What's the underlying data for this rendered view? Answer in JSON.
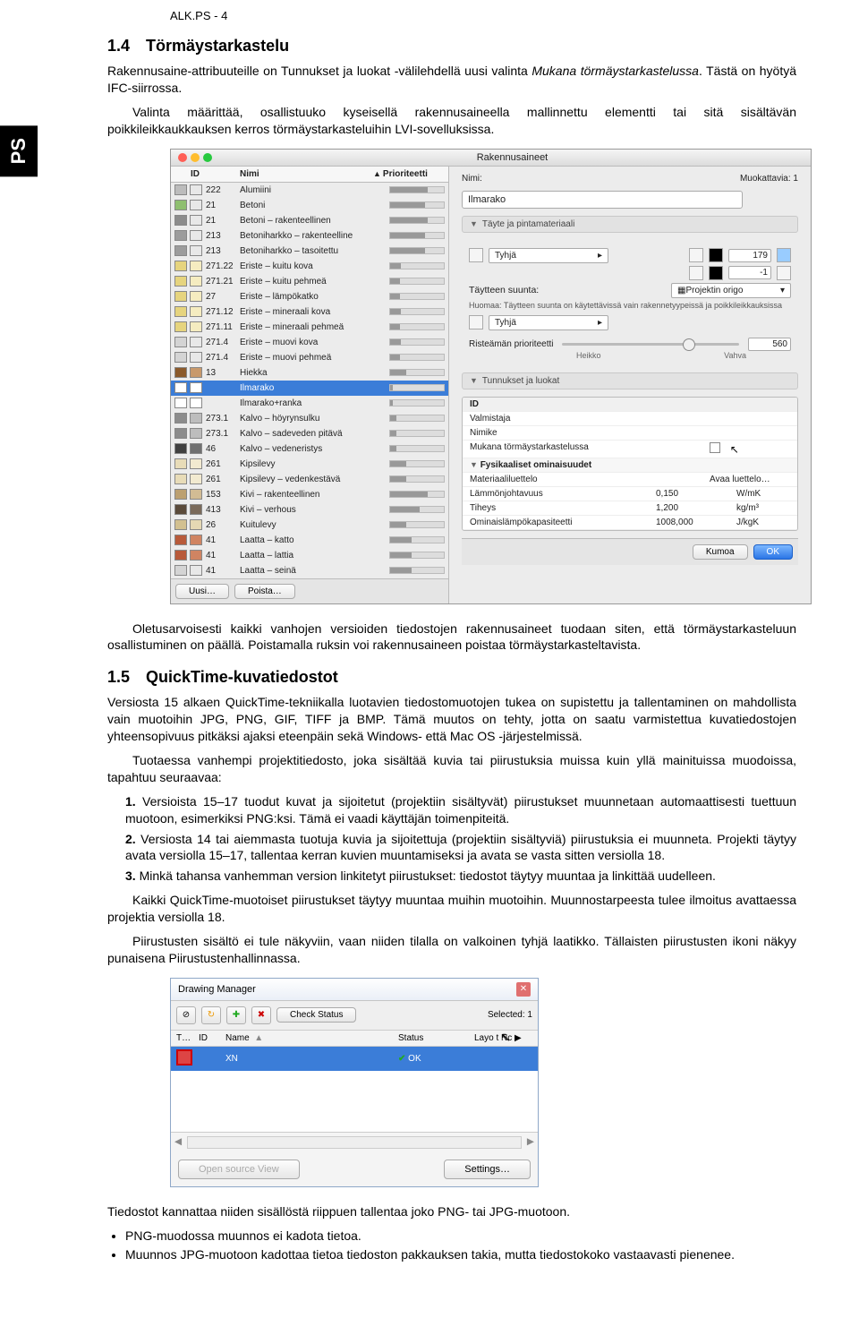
{
  "header": {
    "code": "ALK.PS - 4"
  },
  "ps_tab": "PS",
  "section14": {
    "title": "1.4 Törmäystarkastelu",
    "para1_a": "Rakennusaine-attribuuteille on Tunnukset ja luokat -välilehdellä uusi valinta ",
    "para1_em": "Mukana törmäystarkastelussa",
    "para1_b": ". Tästä on hyötyä IFC-siirrossa.",
    "para2": "Valinta määrittää, osallistuuko kyseisellä rakennusaineella mallinnettu elementti tai sitä sisältävän poikkileikkaukkauksen kerros törmäystarkasteluihin LVI-sovelluksissa."
  },
  "dialog1": {
    "title": "Rakennusaineet",
    "columns": {
      "id": "ID",
      "name": "Nimi",
      "prio": "Prioriteetti"
    },
    "materials": [
      {
        "sw": "#bcbcbc",
        "sw2": "#e8e8e8",
        "id": "222",
        "name": "Alumiini",
        "p": 70
      },
      {
        "sw": "#8fbf70",
        "sw2": "#e8e8e8",
        "id": "21",
        "name": "Betoni",
        "p": 65
      },
      {
        "sw": "#8c8c8c",
        "sw2": "#e8e8e8",
        "id": "21",
        "name": "Betoni – rakenteellinen",
        "p": 70
      },
      {
        "sw": "#9c9c9c",
        "sw2": "#e8e8e8",
        "id": "213",
        "name": "Betoniharkko – rakenteelline",
        "p": 65
      },
      {
        "sw": "#9c9c9c",
        "sw2": "#e8e8e8",
        "id": "213",
        "name": "Betoniharkko – tasoitettu",
        "p": 65
      },
      {
        "sw": "#e6d47e",
        "sw2": "#f5ecc0",
        "id": "271.22",
        "name": "Eriste – kuitu kova",
        "p": 20
      },
      {
        "sw": "#e6d47e",
        "sw2": "#f5ecc0",
        "id": "271.21",
        "name": "Eriste – kuitu pehmeä",
        "p": 18
      },
      {
        "sw": "#e6d47e",
        "sw2": "#f5ecc0",
        "id": "27",
        "name": "Eriste – lämpökatko",
        "p": 18
      },
      {
        "sw": "#e6d47e",
        "sw2": "#f5ecc0",
        "id": "271.12",
        "name": "Eriste – mineraali kova",
        "p": 20
      },
      {
        "sw": "#e6d47e",
        "sw2": "#f5ecc0",
        "id": "271.11",
        "name": "Eriste – mineraali pehmeä",
        "p": 18
      },
      {
        "sw": "#d4d4d4",
        "sw2": "#e8e8e8",
        "id": "271.4",
        "name": "Eriste – muovi kova",
        "p": 20
      },
      {
        "sw": "#d4d4d4",
        "sw2": "#e8e8e8",
        "id": "271.4",
        "name": "Eriste – muovi pehmeä",
        "p": 18
      },
      {
        "sw": "#8b5a2b",
        "sw2": "#c8996b",
        "id": "13",
        "name": "Hiekka",
        "p": 30
      },
      {
        "sw": "#ffffff",
        "sw2": "#ffffff",
        "id": "",
        "name": "Ilmarako",
        "p": 5,
        "sel": true
      },
      {
        "sw": "#ffffff",
        "sw2": "#ffffff",
        "id": "",
        "name": "Ilmarako+ranka",
        "p": 5
      },
      {
        "sw": "#8c8c8c",
        "sw2": "#bdbdbd",
        "id": "273.1",
        "name": "Kalvo – höyrynsulku",
        "p": 12
      },
      {
        "sw": "#8c8c8c",
        "sw2": "#bdbdbd",
        "id": "273.1",
        "name": "Kalvo – sadeveden pitävä",
        "p": 12
      },
      {
        "sw": "#404040",
        "sw2": "#707070",
        "id": "46",
        "name": "Kalvo – vedeneristys",
        "p": 12
      },
      {
        "sw": "#e8dcb8",
        "sw2": "#f2ead0",
        "id": "261",
        "name": "Kipsilevy",
        "p": 30
      },
      {
        "sw": "#e8dcb8",
        "sw2": "#f2ead0",
        "id": "261",
        "name": "Kipsilevy – vedenkestävä",
        "p": 30
      },
      {
        "sw": "#bca070",
        "sw2": "#d2bc94",
        "id": "153",
        "name": "Kivi – rakenteellinen",
        "p": 70
      },
      {
        "sw": "#5a4a3a",
        "sw2": "#7a6a5a",
        "id": "413",
        "name": "Kivi – verhous",
        "p": 55
      },
      {
        "sw": "#d2c090",
        "sw2": "#e5d8b3",
        "id": "26",
        "name": "Kuitulevy",
        "p": 30
      },
      {
        "sw": "#b85a3a",
        "sw2": "#d08462",
        "id": "41",
        "name": "Laatta – katto",
        "p": 40
      },
      {
        "sw": "#b85a3a",
        "sw2": "#d08462",
        "id": "41",
        "name": "Laatta – lattia",
        "p": 40
      },
      {
        "sw": "#d4d4d4",
        "sw2": "#e8e8e8",
        "id": "41",
        "name": "Laatta – seinä",
        "p": 40
      }
    ],
    "buttons": {
      "uusi": "Uusi…",
      "poista": "Poista…",
      "kumoa": "Kumoa",
      "ok": "OK"
    },
    "right": {
      "muokattavia": "Muokattavia: 1",
      "nimi_label": "Nimi:",
      "nimi_value": "Ilmarako",
      "sec1": "Täyte ja pintamateriaali",
      "tyhja": "Tyhjä",
      "v179": "179",
      "vneg1": "-1",
      "tayt_suunta": "Täytteen suunta:",
      "proj_origo": "Projektin origo",
      "huom": "Huomaa: Täytteen suunta on käytettävissä vain rakennetyypeissä ja poikkileikkauksissa",
      "rist": "Risteämän prioriteetti",
      "heikko": "Heikko",
      "vahva": "Vahva",
      "rist_val": "560",
      "sec2": "Tunnukset ja luokat",
      "rows": {
        "id": "ID",
        "valm": "Valmistaja",
        "nimike": "Nimike",
        "mukana": "Mukana törmäystarkastelussa",
        "fys": "Fysikaaliset ominaisuudet",
        "matl": "Materiaaliluettelo",
        "matl_v": "Avaa luettelo…",
        "lammon": "Lämmönjohtavuus",
        "lammon_v": "0,150",
        "lammon_u": "W/mK",
        "tiheys": "Tiheys",
        "tiheys_v": "1,200",
        "tiheys_u": "kg/m³",
        "omin": "Ominaislämpökapasiteetti",
        "omin_v": "1008,000",
        "omin_u": "J/kgK"
      }
    }
  },
  "after1": {
    "p1": "Oletusarvoisesti kaikki vanhojen versioiden tiedostojen rakennusaineet tuodaan siten, että törmäystarkasteluun osallistuminen on päällä. Poistamalla ruksin voi rakennusaineen poistaa törmäystarkasteltavista."
  },
  "section15": {
    "title": "1.5 QuickTime-kuvatiedostot",
    "p1": "Versiosta 15 alkaen QuickTime-tekniikalla luotavien tiedostomuotojen tukea on supistettu ja tallentaminen on mahdollista vain muotoihin JPG, PNG, GIF, TIFF ja BMP. Tämä muutos on tehty, jotta on saatu varmistettua kuvatiedostojen yhteensopivuus pitkäksi ajaksi eteenpäin sekä Windows- että Mac OS -järjestelmissä.",
    "p2": "Tuotaessa vanhempi projektitiedosto, joka sisältää kuvia tai piirustuksia muissa kuin yllä mainituissa muodoissa, tapahtuu seuraavaa:",
    "li1": "Versioista 15–17 tuodut kuvat ja sijoitetut (projektiin sisältyvät) piirustukset muunnetaan automaattisesti tuettuun muotoon, esimerkiksi PNG:ksi. Tämä ei vaadi käyttäjän toimenpiteitä.",
    "li2": "Versiosta 14 tai aiemmasta tuotuja kuvia ja sijoitettuja (projektiin sisältyviä) piirustuksia ei muunneta. Projekti täytyy avata versiolla 15–17, tallentaa kerran kuvien muuntamiseksi ja avata se vasta sitten versiolla 18.",
    "li3": "Minkä tahansa vanhemman version linkitetyt piirustukset: tiedostot täytyy muuntaa ja linkittää uudelleen.",
    "p3": "Kaikki QuickTime-muotoiset piirustukset täytyy muuntaa muihin muotoihin. Muunnostarpeesta tulee ilmoitus avattaessa projektia versiolla 18.",
    "p4": "Piirustusten sisältö ei tule näkyviin, vaan niiden tilalla on valkoinen tyhjä laatikko. Tällaisten piirustusten ikoni näkyy punaisena Piirustustenhallinnassa."
  },
  "dialog2": {
    "title": "Drawing Manager",
    "check": "Check Status",
    "selected": "Selected: 1",
    "head": {
      "t": "T…",
      "id": "ID",
      "name": "Name",
      "status": "Status",
      "layout": "Layo   t Nc ▶"
    },
    "row": {
      "name": "XN",
      "status": "OK"
    },
    "open": "Open source View",
    "settings": "Settings…"
  },
  "footer": {
    "p1": "Tiedostot kannattaa niiden sisällöstä riippuen tallentaa joko PNG- tai JPG-muotoon.",
    "b1": "PNG-muodossa muunnos ei kadota tietoa.",
    "b2": "Muunnos JPG-muotoon kadottaa tietoa tiedoston pakkauksen takia, mutta tiedostokoko vastaavasti pienenee."
  }
}
